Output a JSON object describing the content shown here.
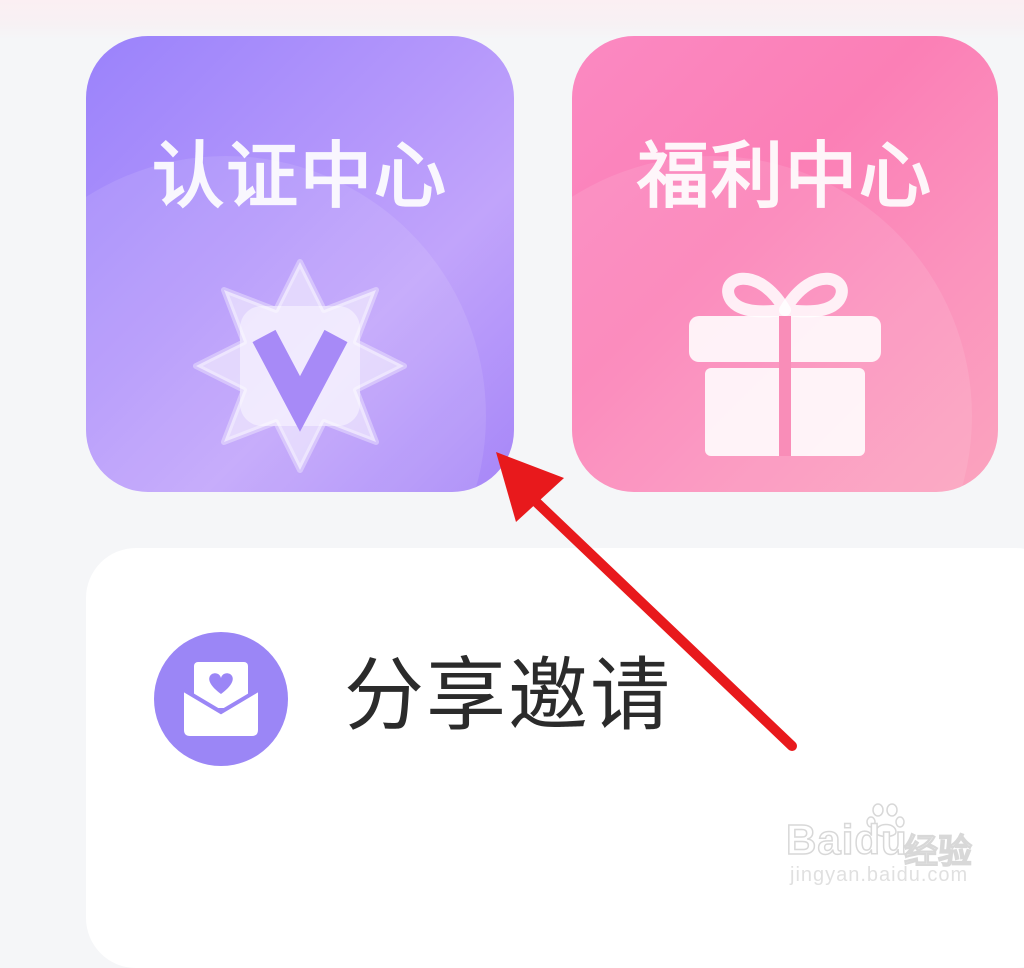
{
  "tiles": {
    "verify": {
      "title": "认证中心",
      "icon": "verified-badge-icon",
      "color": "#a88af9"
    },
    "welfare": {
      "title": "福利中心",
      "icon": "gift-icon",
      "color": "#fb8bbd"
    }
  },
  "share": {
    "label": "分享邀请",
    "icon": "envelope-heart-icon",
    "icon_color": "#9b86f6"
  },
  "annotation": {
    "type": "red-arrow",
    "color": "#e8191c",
    "points_to": "认证中心"
  },
  "watermark": {
    "brand": "Baidu",
    "product": "经验",
    "url": "jingyan.baidu.com"
  }
}
